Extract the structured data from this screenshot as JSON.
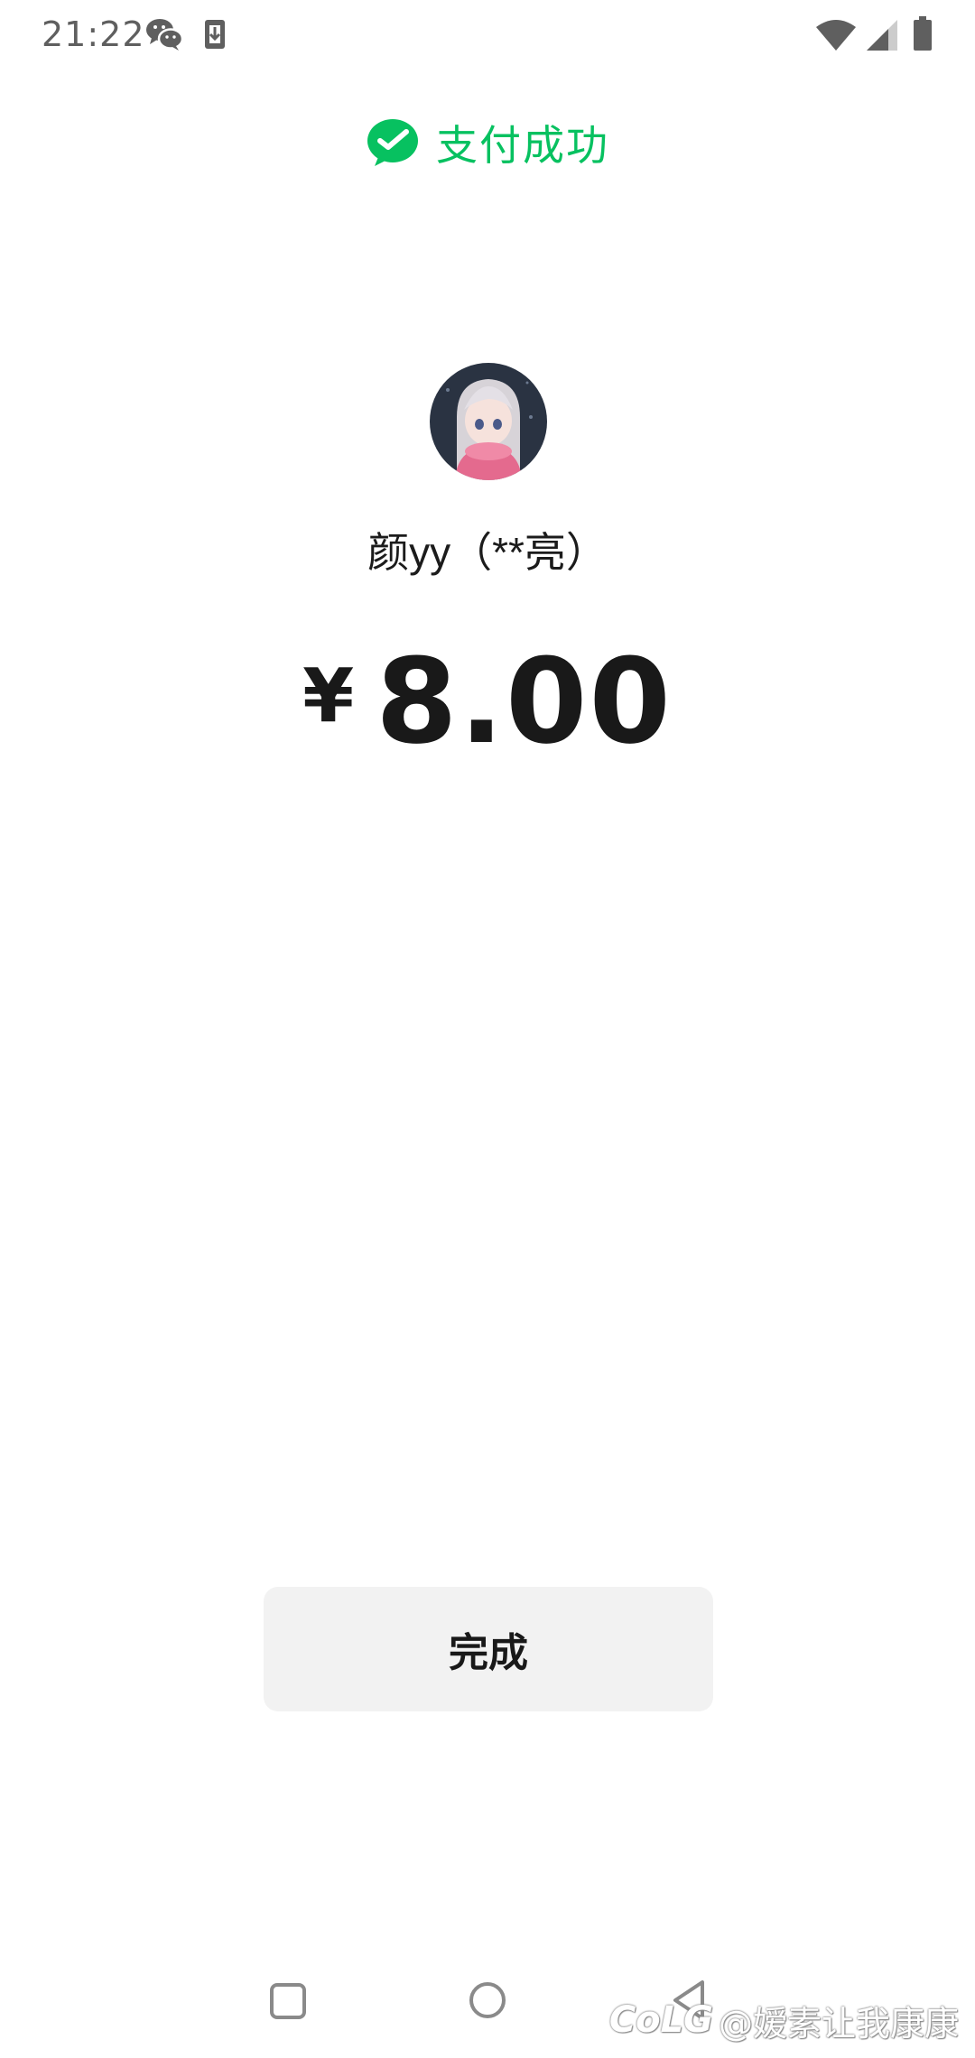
{
  "status_bar": {
    "time": "21:22",
    "icons": [
      "wechat-icon",
      "download-icon",
      "wifi-icon",
      "signal-icon",
      "battery-icon"
    ]
  },
  "header": {
    "title": "支付成功",
    "icon": "wechat-pay-logo-icon",
    "accent_color": "#07C160"
  },
  "payment": {
    "payee_name": "颜yy（**亮）",
    "currency_symbol": "¥",
    "amount": "8.00"
  },
  "actions": {
    "done_label": "完成"
  },
  "navigation_bar": {
    "buttons": [
      "recents-icon",
      "home-icon",
      "back-icon"
    ]
  },
  "watermark": {
    "logo": "CoLG",
    "text": "@嫒素让我康康"
  }
}
